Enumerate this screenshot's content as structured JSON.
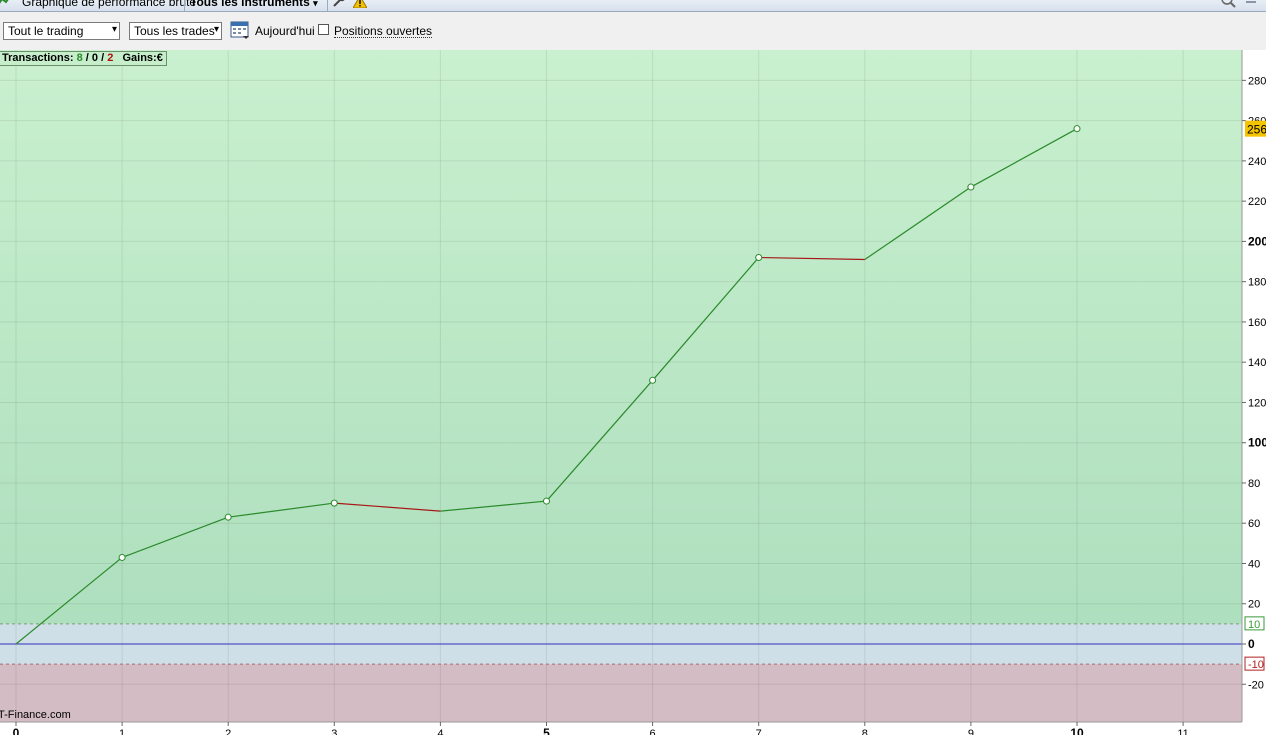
{
  "titlebar": {
    "app_icon": "chart-icon",
    "tab_chart_label": "Graphique de performance brute",
    "tab_instruments_label": "Tous les instruments",
    "tab_instruments_arrow": "▾",
    "wrench_icon": "wrench-icon",
    "warning_icon": "warning-icon",
    "search_icon": "search-icon",
    "minimize_icon": "minimize-icon"
  },
  "toolbar": {
    "trading_select_value": "Tout le trading",
    "trades_select_value": "Tous les trades",
    "calendar_icon": "calendar-icon",
    "today_label": "Aujourd'hui",
    "open_positions_label": "Positions ouvertes",
    "open_positions_checked": false
  },
  "stats": {
    "transactions_label": "Transactions:",
    "wins": "8",
    "sep1": " / ",
    "neutral": "0",
    "sep2": " / ",
    "losses": "2",
    "gains_label": "Gains:",
    "gains_value": "€"
  },
  "watermark": "T-Finance.com",
  "colors": {
    "gain_line": "#2a8a2a",
    "loss_line": "#a81616",
    "zero_line": "#3030c0",
    "positive_zone_top": "#c9f0cf",
    "positive_zone_bottom": "#aedfbe",
    "neutral_zone": "#cfdfe8",
    "negative_zone": "#d4bcc5",
    "last_value_badge": "#f5c400",
    "threshold_positive": "#3a9a3a",
    "threshold_negative": "#b02020"
  },
  "chart_data": {
    "type": "line",
    "x": [
      0,
      1,
      2,
      3,
      4,
      5,
      6,
      7,
      8,
      9,
      10
    ],
    "values": [
      0,
      43,
      63,
      70,
      66,
      71,
      131,
      192,
      191,
      227,
      256
    ],
    "xlim": [
      0,
      11
    ],
    "ylim": [
      -20,
      280
    ],
    "x_ticks": [
      "0",
      "1",
      "2",
      "3",
      "4",
      "5",
      "6",
      "7",
      "8",
      "9",
      "10",
      "11"
    ],
    "x_ticks_bold": [
      "0",
      "5",
      "10"
    ],
    "y_ticks": [
      "280",
      "260",
      "240",
      "220",
      "200",
      "180",
      "160",
      "140",
      "120",
      "100",
      "80",
      "60",
      "40",
      "20",
      "0",
      "-20"
    ],
    "y_ticks_bold": [
      "200",
      "100",
      "0"
    ],
    "threshold_positive": 10,
    "threshold_positive_label": "10",
    "threshold_negative": -10,
    "threshold_negative_label": "-10",
    "last_value_label": "256",
    "grid": true
  }
}
